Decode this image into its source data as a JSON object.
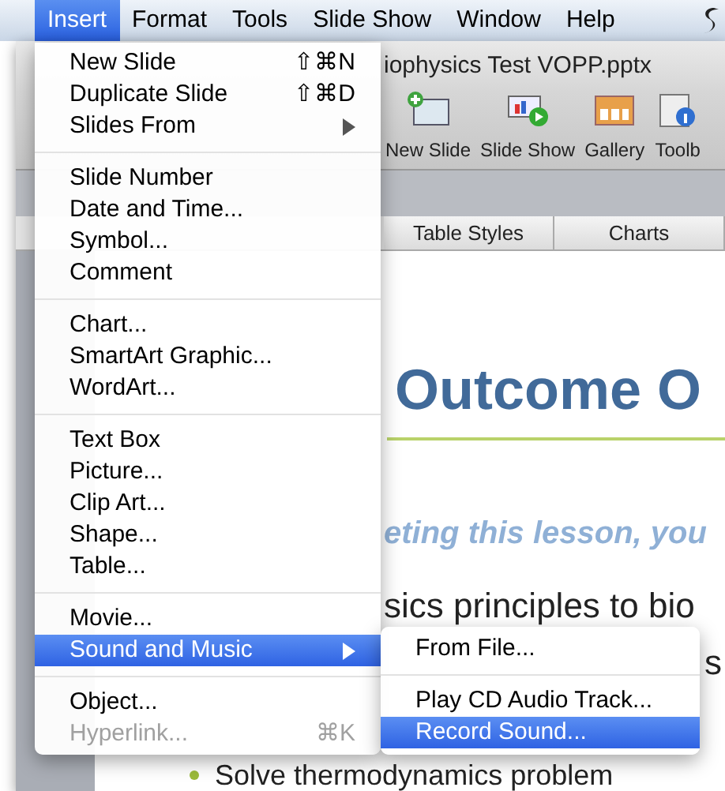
{
  "menu_bar": [
    {
      "label": "Insert",
      "selected": true
    },
    {
      "label": "Format",
      "selected": false
    },
    {
      "label": "Tools",
      "selected": false
    },
    {
      "label": "Slide Show",
      "selected": false
    },
    {
      "label": "Window",
      "selected": false
    },
    {
      "label": "Help",
      "selected": false
    }
  ],
  "window": {
    "title": "iophysics Test VOPP.pptx",
    "toolbar": [
      {
        "label": "New Slide",
        "kind": "new-slide"
      },
      {
        "label": "Slide Show",
        "kind": "slide-show"
      },
      {
        "label": "Gallery",
        "kind": "gallery"
      },
      {
        "label": "Toolb",
        "kind": "toolbox"
      }
    ],
    "ribbon_tabs": [
      "Table Styles",
      "Charts"
    ],
    "slide": {
      "title": "Outcome O",
      "subtitle": "eting this lesson, you",
      "bullets": [
        "sics principles to bio",
        "s",
        "Solve thermodynamics problem"
      ]
    }
  },
  "insert_menu": [
    {
      "kind": "item",
      "label": "New Slide",
      "shortcut": "⇧⌘N",
      "submenu": false,
      "disabled": false,
      "selected": false
    },
    {
      "kind": "item",
      "label": "Duplicate Slide",
      "shortcut": "⇧⌘D",
      "submenu": false,
      "disabled": false,
      "selected": false
    },
    {
      "kind": "item",
      "label": "Slides From",
      "submenu": true,
      "disabled": false,
      "selected": false
    },
    {
      "kind": "separator"
    },
    {
      "kind": "item",
      "label": "Slide Number",
      "submenu": false,
      "disabled": false,
      "selected": false
    },
    {
      "kind": "item",
      "label": "Date and Time...",
      "submenu": false,
      "disabled": false,
      "selected": false
    },
    {
      "kind": "item",
      "label": "Symbol...",
      "submenu": false,
      "disabled": false,
      "selected": false
    },
    {
      "kind": "item",
      "label": "Comment",
      "submenu": false,
      "disabled": false,
      "selected": false
    },
    {
      "kind": "separator"
    },
    {
      "kind": "item",
      "label": "Chart...",
      "submenu": false,
      "disabled": false,
      "selected": false
    },
    {
      "kind": "item",
      "label": "SmartArt Graphic...",
      "submenu": false,
      "disabled": false,
      "selected": false
    },
    {
      "kind": "item",
      "label": "WordArt...",
      "submenu": false,
      "disabled": false,
      "selected": false
    },
    {
      "kind": "separator"
    },
    {
      "kind": "item",
      "label": "Text Box",
      "submenu": false,
      "disabled": false,
      "selected": false
    },
    {
      "kind": "item",
      "label": "Picture...",
      "submenu": false,
      "disabled": false,
      "selected": false
    },
    {
      "kind": "item",
      "label": "Clip Art...",
      "submenu": false,
      "disabled": false,
      "selected": false
    },
    {
      "kind": "item",
      "label": "Shape...",
      "submenu": false,
      "disabled": false,
      "selected": false
    },
    {
      "kind": "item",
      "label": "Table...",
      "submenu": false,
      "disabled": false,
      "selected": false
    },
    {
      "kind": "separator"
    },
    {
      "kind": "item",
      "label": "Movie...",
      "submenu": false,
      "disabled": false,
      "selected": false
    },
    {
      "kind": "item",
      "label": "Sound and Music",
      "submenu": true,
      "disabled": false,
      "selected": true
    },
    {
      "kind": "separator"
    },
    {
      "kind": "item",
      "label": "Object...",
      "submenu": false,
      "disabled": false,
      "selected": false
    },
    {
      "kind": "item",
      "label": "Hyperlink...",
      "shortcut": "⌘K",
      "submenu": false,
      "disabled": true,
      "selected": false
    }
  ],
  "sound_submenu": [
    {
      "kind": "item",
      "label": "From File...",
      "selected": false
    },
    {
      "kind": "separator"
    },
    {
      "kind": "item",
      "label": "Play CD Audio Track...",
      "selected": false
    },
    {
      "kind": "item",
      "label": "Record Sound...",
      "selected": true
    }
  ]
}
